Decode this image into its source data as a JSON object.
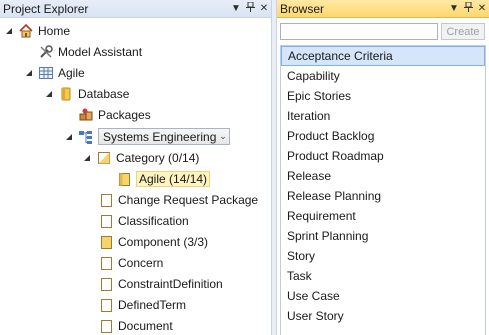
{
  "project_explorer": {
    "title": "Project Explorer",
    "pin_icon": "pin-icon",
    "close_icon": "close-icon",
    "menu_icon": "chevron-down-icon",
    "tree": {
      "home": "Home",
      "model_assistant": "Model Assistant",
      "agile": "Agile",
      "database": "Database",
      "packages": "Packages",
      "view_selector": "Systems Engineering",
      "category": "Category  (0/14)",
      "agile_child": "Agile  (14/14)",
      "items": [
        "Change Request Package",
        "Classification",
        "Component  (3/3)",
        "Concern",
        "ConstraintDefinition",
        "DefinedTerm",
        "Document"
      ]
    }
  },
  "browser": {
    "title": "Browser",
    "search_placeholder": "",
    "create_label": "Create",
    "items": [
      "Acceptance Criteria",
      "Capability",
      "Epic Stories",
      "Iteration",
      "Product Backlog",
      "Product Roadmap",
      "Release",
      "Release Planning",
      "Requirement",
      "Sprint Planning",
      "Story",
      "Task",
      "Use Case",
      "User Story"
    ],
    "selected_index": 0
  },
  "colors": {
    "browser_title_bg": "#fcd86c",
    "explorer_title_bg": "#d9e3f2",
    "selection_bg": "#d5e6fb",
    "folder_yellow": "#f6d36b"
  }
}
